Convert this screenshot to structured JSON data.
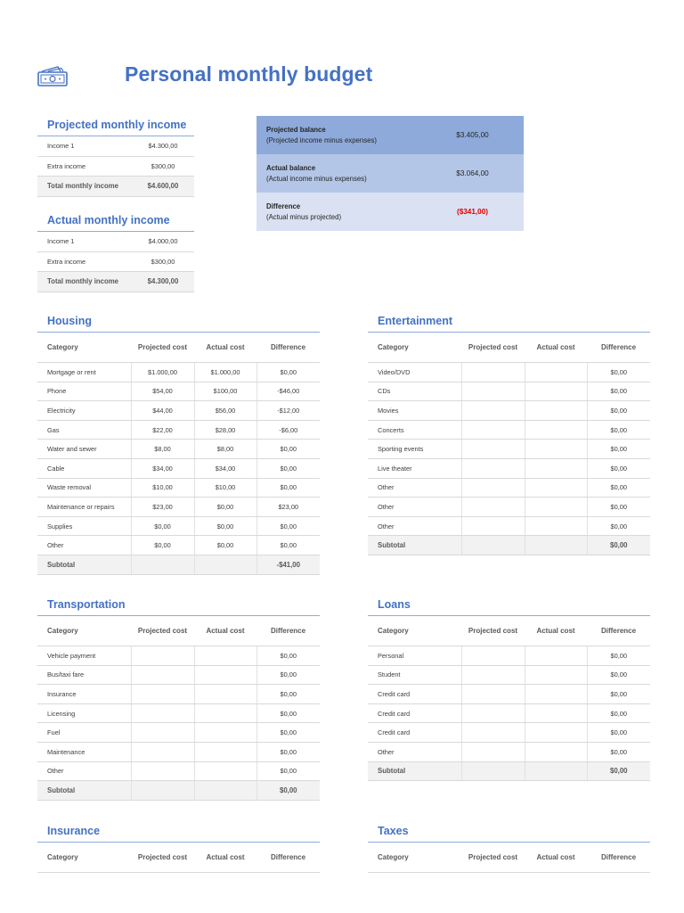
{
  "title": "Personal monthly budget",
  "icons": {
    "logo": "money-bill-icon"
  },
  "colors": {
    "accent": "#4472c4",
    "negative": "#e00000",
    "balance_dark": "#8eaadb",
    "balance_mid": "#b4c6e7",
    "balance_light": "#d9e1f2"
  },
  "projected_income": {
    "title": "Projected monthly income",
    "rows": [
      {
        "label": "Income 1",
        "value": "$4.300,00"
      },
      {
        "label": "Extra income",
        "value": "$300,00"
      }
    ],
    "total": {
      "label": "Total monthly income",
      "value": "$4.600,00"
    }
  },
  "actual_income": {
    "title": "Actual monthly income",
    "rows": [
      {
        "label": "Income 1",
        "value": "$4.000,00"
      },
      {
        "label": "Extra income",
        "value": "$300,00"
      }
    ],
    "total": {
      "label": "Total monthly income",
      "value": "$4.300,00"
    }
  },
  "balance": [
    {
      "title": "Projected balance",
      "subtitle": "(Projected income minus expenses)",
      "value": "$3.405,00"
    },
    {
      "title": "Actual balance",
      "subtitle": "(Actual income minus expenses)",
      "value": "$3.064,00"
    },
    {
      "title": "Difference",
      "subtitle": "(Actual minus projected)",
      "value": "($341,00)"
    }
  ],
  "headers": {
    "category": "Category",
    "projected": "Projected cost",
    "actual": "Actual cost",
    "difference": "Difference"
  },
  "housing": {
    "title": "Housing",
    "rows": [
      {
        "category": "Mortgage or rent",
        "projected": "$1.000,00",
        "actual": "$1.000,00",
        "difference": "$0,00"
      },
      {
        "category": "Phone",
        "projected": "$54,00",
        "actual": "$100,00",
        "difference": "-$46,00"
      },
      {
        "category": "Electricity",
        "projected": "$44,00",
        "actual": "$56,00",
        "difference": "-$12,00"
      },
      {
        "category": "Gas",
        "projected": "$22,00",
        "actual": "$28,00",
        "difference": "-$6,00"
      },
      {
        "category": "Water and sewer",
        "projected": "$8,00",
        "actual": "$8,00",
        "difference": "$0,00"
      },
      {
        "category": "Cable",
        "projected": "$34,00",
        "actual": "$34,00",
        "difference": "$0,00"
      },
      {
        "category": "Waste removal",
        "projected": "$10,00",
        "actual": "$10,00",
        "difference": "$0,00"
      },
      {
        "category": "Maintenance or repairs",
        "projected": "$23,00",
        "actual": "$0,00",
        "difference": "$23,00"
      },
      {
        "category": "Supplies",
        "projected": "$0,00",
        "actual": "$0,00",
        "difference": "$0,00"
      },
      {
        "category": "Other",
        "projected": "$0,00",
        "actual": "$0,00",
        "difference": "$0,00"
      }
    ],
    "subtotal": {
      "label": "Subtotal",
      "difference": "-$41,00"
    }
  },
  "entertainment": {
    "title": "Entertainment",
    "rows": [
      {
        "category": "Video/DVD",
        "projected": "",
        "actual": "",
        "difference": "$0,00"
      },
      {
        "category": "CDs",
        "projected": "",
        "actual": "",
        "difference": "$0,00"
      },
      {
        "category": "Movies",
        "projected": "",
        "actual": "",
        "difference": "$0,00"
      },
      {
        "category": "Concerts",
        "projected": "",
        "actual": "",
        "difference": "$0,00"
      },
      {
        "category": "Sporting events",
        "projected": "",
        "actual": "",
        "difference": "$0,00"
      },
      {
        "category": "Live theater",
        "projected": "",
        "actual": "",
        "difference": "$0,00"
      },
      {
        "category": "Other",
        "projected": "",
        "actual": "",
        "difference": "$0,00"
      },
      {
        "category": "Other",
        "projected": "",
        "actual": "",
        "difference": "$0,00"
      },
      {
        "category": "Other",
        "projected": "",
        "actual": "",
        "difference": "$0,00"
      }
    ],
    "subtotal": {
      "label": "Subtotal",
      "difference": "$0,00"
    }
  },
  "transportation": {
    "title": "Transportation",
    "rows": [
      {
        "category": "Vehicle payment",
        "projected": "",
        "actual": "",
        "difference": "$0,00"
      },
      {
        "category": "Bus/taxi fare",
        "projected": "",
        "actual": "",
        "difference": "$0,00"
      },
      {
        "category": "Insurance",
        "projected": "",
        "actual": "",
        "difference": "$0,00"
      },
      {
        "category": "Licensing",
        "projected": "",
        "actual": "",
        "difference": "$0,00"
      },
      {
        "category": "Fuel",
        "projected": "",
        "actual": "",
        "difference": "$0,00"
      },
      {
        "category": "Maintenance",
        "projected": "",
        "actual": "",
        "difference": "$0,00"
      },
      {
        "category": "Other",
        "projected": "",
        "actual": "",
        "difference": "$0,00"
      }
    ],
    "subtotal": {
      "label": "Subtotal",
      "difference": "$0,00"
    }
  },
  "loans": {
    "title": "Loans",
    "rows": [
      {
        "category": "Personal",
        "projected": "",
        "actual": "",
        "difference": "$0,00"
      },
      {
        "category": "Student",
        "projected": "",
        "actual": "",
        "difference": "$0,00"
      },
      {
        "category": "Credit card",
        "projected": "",
        "actual": "",
        "difference": "$0,00"
      },
      {
        "category": "Credit card",
        "projected": "",
        "actual": "",
        "difference": "$0,00"
      },
      {
        "category": "Credit card",
        "projected": "",
        "actual": "",
        "difference": "$0,00"
      },
      {
        "category": "Other",
        "projected": "",
        "actual": "",
        "difference": "$0,00"
      }
    ],
    "subtotal": {
      "label": "Subtotal",
      "difference": "$0,00"
    }
  },
  "insurance": {
    "title": "Insurance",
    "rows": []
  },
  "taxes": {
    "title": "Taxes",
    "rows": []
  }
}
